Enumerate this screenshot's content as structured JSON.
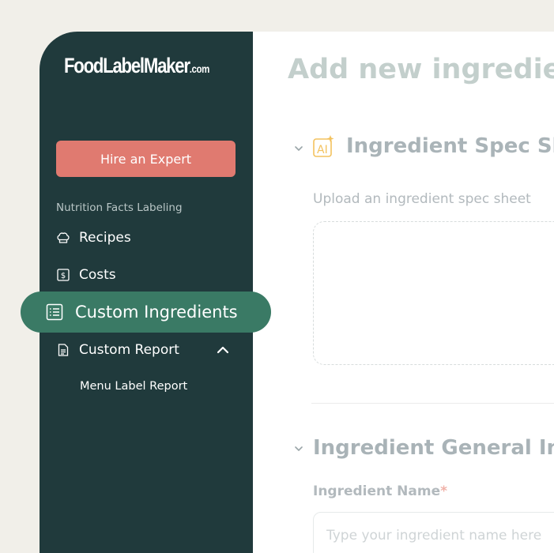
{
  "brand": {
    "logo_main": "FoodLabelMaker",
    "logo_suffix": ".com"
  },
  "sidebar": {
    "hire_button": "Hire an Expert",
    "section_label": "Nutrition Facts Labeling",
    "items": [
      {
        "label": "Recipes",
        "icon": "chef-hat-icon"
      },
      {
        "label": "Costs",
        "icon": "dollar-box-icon"
      },
      {
        "label": "Custom Ingredients",
        "icon": "list-icon",
        "active": true
      },
      {
        "label": "Custom Report",
        "icon": "document-icon",
        "expanded": true
      }
    ],
    "sub_items": [
      {
        "label": "Menu Label Report"
      }
    ]
  },
  "main": {
    "title": "Add new ingredient",
    "spec_section": {
      "title": "Ingredient Spec Sheet",
      "upload_text": "Upload an ingredient spec sheet"
    },
    "general_section": {
      "title": "Ingredient General Information",
      "name_label": "Ingredient Name",
      "required_mark": "*",
      "name_placeholder": "Type your ingredient name here"
    }
  },
  "colors": {
    "sidebar_bg": "#203a3c",
    "active_pill": "#3a7a65",
    "hire_button": "#e07a70",
    "backdrop": "#f1efe9",
    "ai_icon": "#f3c25f"
  }
}
